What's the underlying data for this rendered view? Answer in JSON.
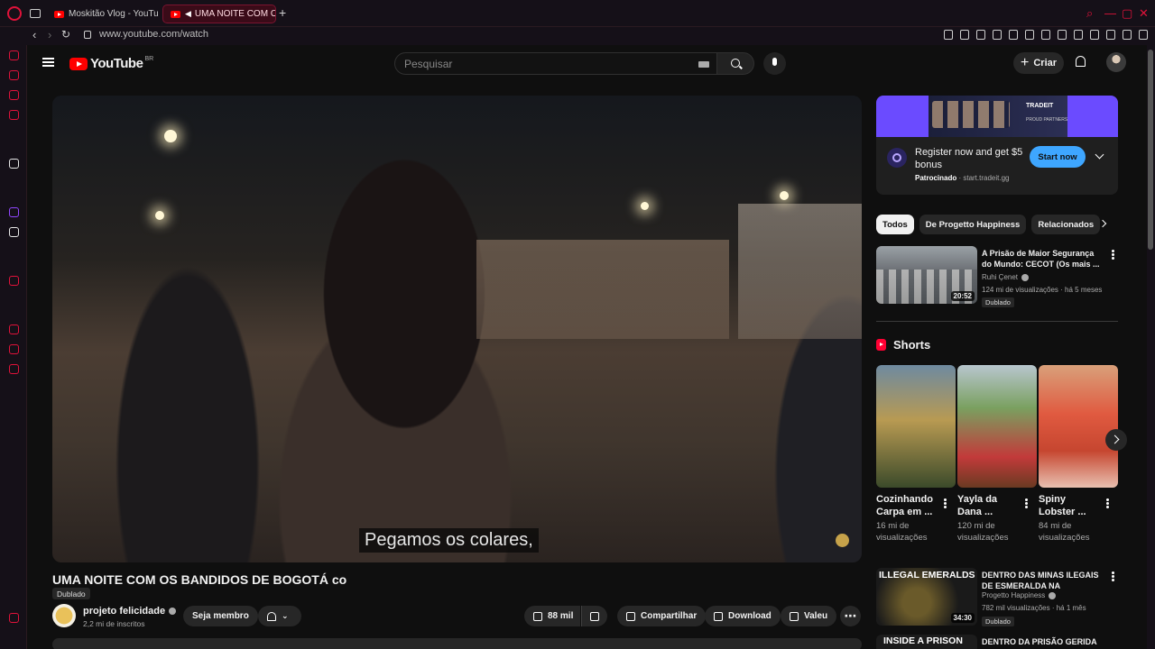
{
  "browser": {
    "tabs": [
      {
        "label": "Moskitão Vlog - YouTube"
      },
      {
        "label": "UMA NOITE COM OS"
      }
    ],
    "new_tab": "+",
    "url": "www.youtube.com/watch"
  },
  "header": {
    "logo_text": "YouTube",
    "country_code": "BR",
    "search_placeholder": "Pesquisar",
    "create_label": "Criar"
  },
  "player": {
    "subtitle": "Pegamos os colares,"
  },
  "video": {
    "title": "UMA NOITE COM OS BANDIDOS DE BOGOTÁ co",
    "dub_badge": "Dublado",
    "channel_name": "projeto felicidade",
    "subscribers": "2,2 mi de inscritos",
    "join_label": "Seja membro",
    "likes": "88 mil",
    "share_label": "Compartilhar",
    "download_label": "Download",
    "thanks_label": "Valeu"
  },
  "ad": {
    "brand": "TRADEIT",
    "brand_sub": "PROUD PARTNERS",
    "title": "Register now and get $5 bonus",
    "sponsored": "Patrocinado",
    "source": "start.tradeit.gg",
    "cta": "Start now"
  },
  "chips": [
    {
      "label": "Todos"
    },
    {
      "label": "De Progetto Happiness"
    },
    {
      "label": "Relacionados"
    }
  ],
  "recommendations": [
    {
      "title": "A Prisão de Maior Segurança do Mundo: CECOT (Os mais ...",
      "channel": "Ruhi Çenet",
      "meta": "124 mi de visualizações · há 5 meses",
      "badge": "Dublado",
      "duration": "20:52"
    },
    {
      "title": "DENTRO DAS MINAS ILEGAIS DE ESMERALDA NA COLÔMBI...",
      "channel": "Progetto Happiness",
      "meta": "782 mil visualizações · há 1 mês",
      "badge": "Dublado",
      "duration": "34:30",
      "thumb_text": "ILLEGAL EMERALDS"
    },
    {
      "title": "DENTRO DA PRISÃO GERIDA",
      "thumb_text": "INSIDE A PRISON"
    }
  ],
  "shorts": {
    "heading": "Shorts",
    "items": [
      {
        "title": "Cozinhando Carpa em ...",
        "views": "16 mi de visualizações"
      },
      {
        "title": "Yayla da Dana ...",
        "views": "120 mi de visualizações"
      },
      {
        "title": "Spiny Lobster ...",
        "views": "84 mi de visualizações"
      }
    ]
  },
  "colors": {
    "opera_red": "#e0123a",
    "youtube_red": "#ff0000",
    "cta_blue": "#3ea6ff",
    "background": "#0f0f0f"
  }
}
